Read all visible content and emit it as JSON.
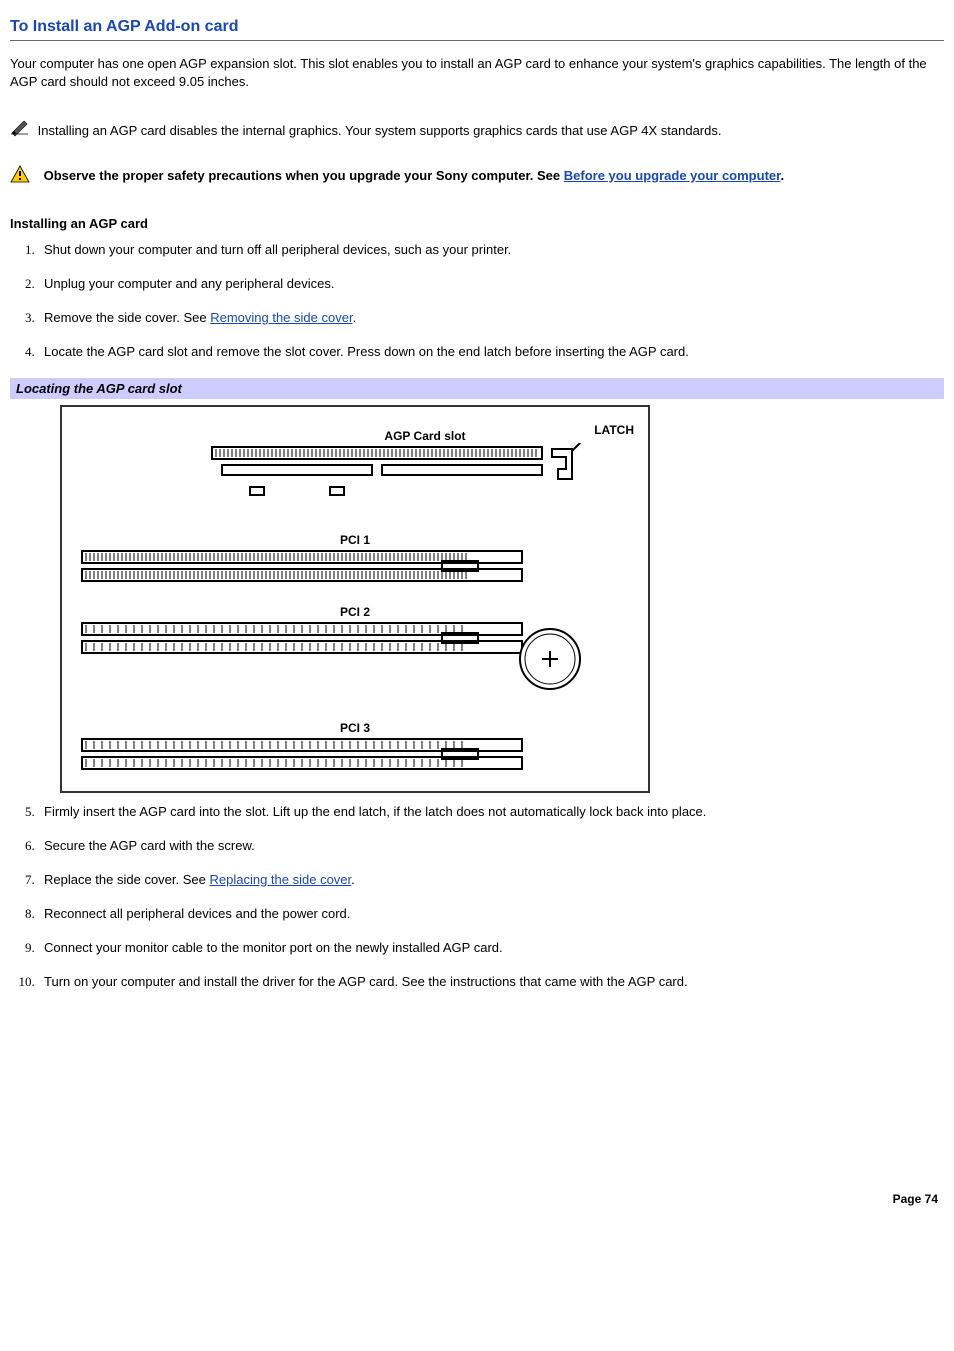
{
  "title": "To Install an AGP Add-on card",
  "intro": "Your computer has one open AGP expansion slot. This slot enables you to install an AGP card to enhance your system's graphics capabilities. The length of the AGP card should not exceed 9.05 inches.",
  "note": "Installing an AGP card disables the internal graphics. Your system supports graphics cards that use AGP 4X standards.",
  "warn": {
    "prefix": "Observe the proper safety precautions when you upgrade your Sony computer. See ",
    "link": "Before you upgrade your computer",
    "suffix": "."
  },
  "sub_head": "Installing an AGP card",
  "steps": {
    "s1": "Shut down your computer and turn off all peripheral devices, such as your printer.",
    "s2": "Unplug your computer and any peripheral devices.",
    "s3_pre": "Remove the side cover. See ",
    "s3_link": "Removing the side cover",
    "s3_post": ".",
    "s4": "Locate the AGP card slot and remove the slot cover. Press down on the end latch before inserting the AGP card.",
    "s5": "Firmly insert the AGP card into the slot. Lift up the end latch, if the latch does not automatically lock back into place.",
    "s6": "Secure the AGP card with the screw.",
    "s7_pre": "Replace the side cover. See ",
    "s7_link": "Replacing the side cover",
    "s7_post": ".",
    "s8": "Reconnect all peripheral devices and the power cord.",
    "s9": "Connect your monitor cable to the monitor port on the newly installed AGP card.",
    "s10": "Turn on your computer and install the driver for the AGP card. See the instructions that came with the AGP card."
  },
  "figure": {
    "caption": "Locating the AGP card slot",
    "agp_label": "AGP Card slot",
    "latch_label": "LATCH",
    "pci1": "PCI 1",
    "pci2": "PCI 2",
    "pci3": "PCI 3"
  },
  "page_number": "Page 74"
}
